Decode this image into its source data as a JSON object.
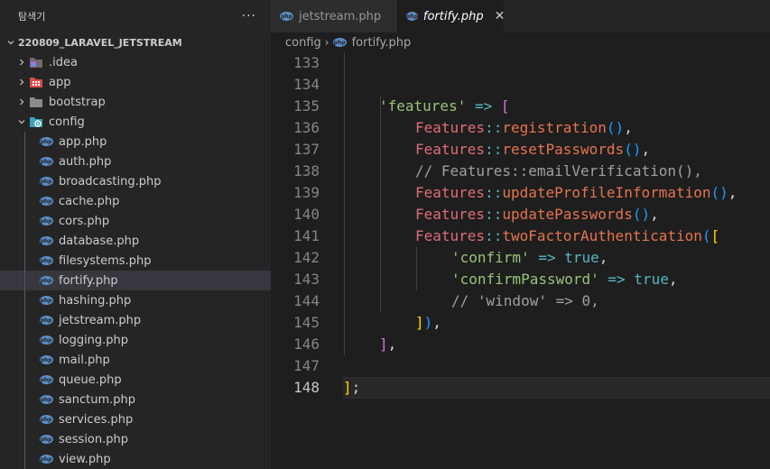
{
  "sidebar": {
    "title": "탐색기",
    "more": "···",
    "root": "220809_LARAVEL_JETSTREAM",
    "folders": [
      {
        "label": ".idea",
        "icon": "idea-folder-icon"
      },
      {
        "label": "app",
        "icon": "app-folder-icon"
      },
      {
        "label": "bootstrap",
        "icon": "folder-icon"
      },
      {
        "label": "config",
        "icon": "config-folder-icon"
      }
    ],
    "files": [
      "app.php",
      "auth.php",
      "broadcasting.php",
      "cache.php",
      "cors.php",
      "database.php",
      "filesystems.php",
      "fortify.php",
      "hashing.php",
      "jetstream.php",
      "logging.php",
      "mail.php",
      "queue.php",
      "sanctum.php",
      "services.php",
      "session.php",
      "view.php"
    ],
    "active_file": "fortify.php"
  },
  "tabs": [
    {
      "label": "jetstream.php",
      "active": false
    },
    {
      "label": "fortify.php",
      "active": true,
      "close": "✕"
    }
  ],
  "breadcrumb": {
    "folder": "config",
    "sep": "›",
    "file": "fortify.php"
  },
  "editor": {
    "line_numbers": [
      "133",
      "134",
      "135",
      "136",
      "137",
      "138",
      "139",
      "140",
      "141",
      "142",
      "143",
      "144",
      "145",
      "146",
      "147",
      "148"
    ],
    "current_line": "148",
    "lines": {
      "l134_key": "'features'",
      "l134_arrow": " => ",
      "l134_br": "[",
      "features": "Features",
      "sep": "::",
      "l135_fn": "registration",
      "l136_fn": "resetPasswords",
      "l137_comment": "// Features::emailVerification(),",
      "l138_fn": "updateProfileInformation",
      "l139_fn": "updatePasswords",
      "l140_fn": "twoFactorAuthentication",
      "l141_key": "'confirm'",
      "l142_key": "'confirmPassword'",
      "arrow": " => ",
      "true": "true",
      "comma": ",",
      "l143_comment": "// 'window' => 0,",
      "l144_close": "]",
      "l144_paren": ")",
      "l145_close": "]",
      "l147_close": "]",
      "l147_semi": ";"
    }
  },
  "colors": {
    "sidebar_bg": "#252526",
    "editor_bg": "#1e1e1e",
    "active_row": "#37373d",
    "php_badge": "#5c8ec6",
    "class": "#e06c75",
    "method": "#e5734f",
    "string": "#98c379"
  }
}
